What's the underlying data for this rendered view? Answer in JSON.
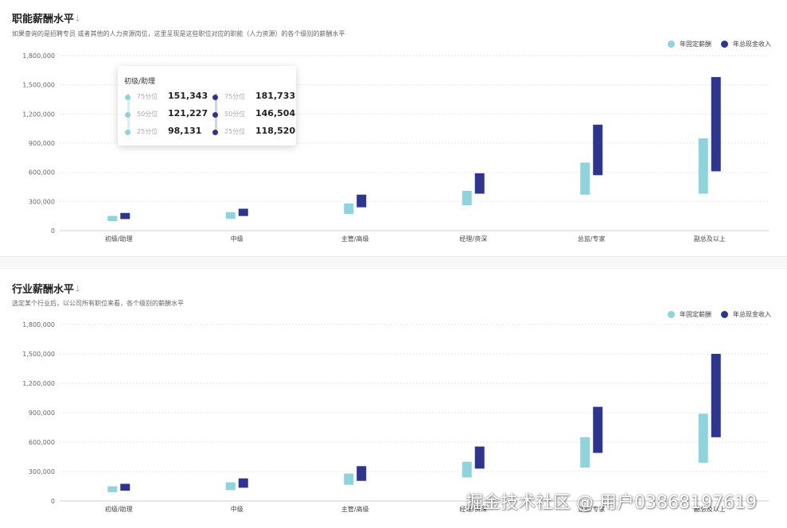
{
  "colors": {
    "fixed": "#8fd3dd",
    "cash": "#2e3590",
    "grid": "#e9e9e9",
    "axis": "#cfcfcf"
  },
  "legend": {
    "fixed_label": "年固定薪酬",
    "cash_label": "年总现金收入"
  },
  "panels": [
    {
      "title": "职能薪酬水平",
      "arrow": "↓",
      "desc": "如果查询的是招聘专员 或者其他的人力资源岗位，这里呈现是这些职位对应的职能（人力资源）的各个级别的薪酬水平"
    },
    {
      "title": "行业薪酬水平",
      "arrow": "↓",
      "desc": "选定某个行业后，以公司所有职位来看，各个级别的薪酬水平"
    }
  ],
  "tooltip": {
    "title": "初级/助理",
    "fixed": [
      {
        "label": "75分位",
        "value": "151,343"
      },
      {
        "label": "50分位",
        "value": "121,227"
      },
      {
        "label": "25分位",
        "value": "98,131"
      }
    ],
    "cash": [
      {
        "label": "75分位",
        "value": "181,733"
      },
      {
        "label": "50分位",
        "value": "146,504"
      },
      {
        "label": "25分位",
        "value": "118,520"
      }
    ]
  },
  "watermark": "掘金技术社区 @ 用户03868197619",
  "chart_data": [
    {
      "type": "bar",
      "title": "职能薪酬水平",
      "categories": [
        "初级/助理",
        "中级",
        "主管/高级",
        "经理/资深",
        "总监/专家",
        "副总及以上"
      ],
      "ylim": [
        0,
        1800000
      ],
      "yticks": [
        "0",
        "300,000",
        "600,000",
        "900,000",
        "1,200,000",
        "1,500,000",
        "1,800,000"
      ],
      "series": [
        {
          "name": "年固定薪酬",
          "low": [
            98131,
            120000,
            170000,
            260000,
            370000,
            380000
          ],
          "high": [
            151343,
            190000,
            280000,
            410000,
            700000,
            950000
          ]
        },
        {
          "name": "年总现金收入",
          "low": [
            118520,
            150000,
            240000,
            380000,
            570000,
            610000
          ],
          "high": [
            181733,
            225000,
            370000,
            590000,
            1090000,
            1580000
          ]
        }
      ]
    },
    {
      "type": "bar",
      "title": "行业薪酬水平",
      "categories": [
        "初级/助理",
        "中级",
        "主管/高级",
        "经理/资深",
        "总监/专家",
        "副总及以上"
      ],
      "ylim": [
        0,
        1800000
      ],
      "yticks": [
        "0",
        "300,000",
        "600,000",
        "900,000",
        "1,200,000",
        "1,500,000",
        "1,800,000"
      ],
      "series": [
        {
          "name": "年固定薪酬",
          "low": [
            90000,
            110000,
            165000,
            240000,
            340000,
            390000
          ],
          "high": [
            150000,
            190000,
            280000,
            400000,
            650000,
            890000
          ]
        },
        {
          "name": "年总现金收入",
          "low": [
            105000,
            135000,
            205000,
            330000,
            490000,
            650000
          ],
          "high": [
            175000,
            230000,
            355000,
            555000,
            960000,
            1500000
          ]
        }
      ]
    }
  ]
}
